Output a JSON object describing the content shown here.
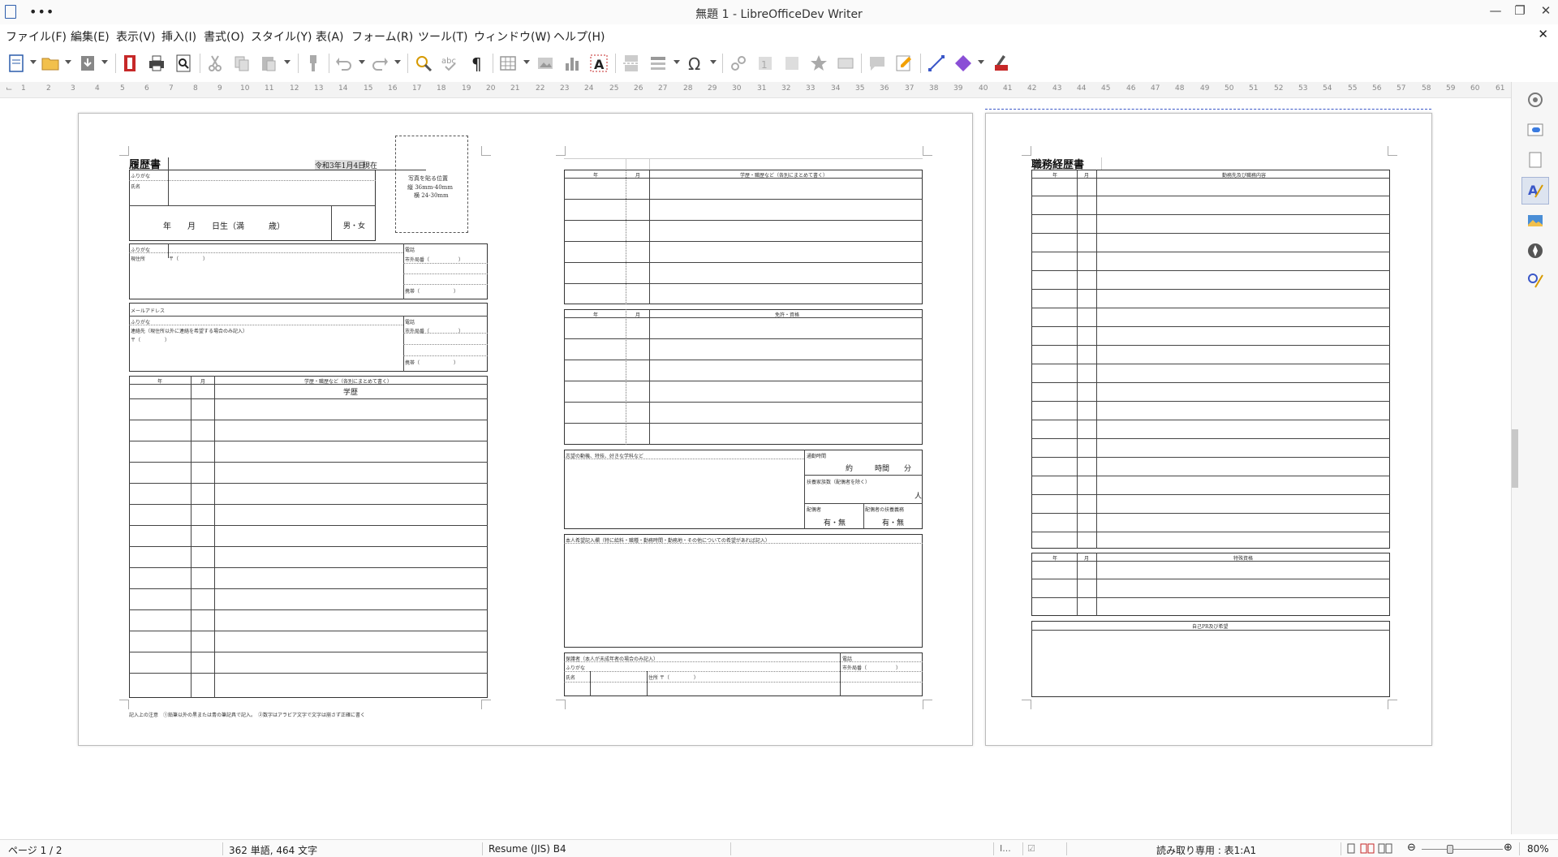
{
  "window": {
    "title": "無題 1 - LibreOfficeDev Writer",
    "more_label": "•••"
  },
  "menu": {
    "items": [
      "ファイル(F)",
      "編集(E)",
      "表示(V)",
      "挿入(I)",
      "書式(O)",
      "スタイル(Y)",
      "表(A)",
      "フォーム(R)",
      "ツール(T)",
      "ウィンドウ(W)",
      "ヘルプ(H)"
    ]
  },
  "ruler": {
    "ticks": [
      "1",
      "2",
      "3",
      "4",
      "5",
      "6",
      "7",
      "8",
      "9",
      "10",
      "11",
      "12",
      "13",
      "14",
      "15",
      "16",
      "17",
      "18",
      "19",
      "20",
      "21",
      "22",
      "23",
      "24",
      "25",
      "26",
      "27",
      "28",
      "29",
      "30",
      "31",
      "32",
      "33",
      "34",
      "35",
      "36",
      "37",
      "38",
      "39",
      "40",
      "41",
      "42",
      "43",
      "44",
      "45",
      "46",
      "47",
      "48",
      "49",
      "50",
      "51",
      "52",
      "53",
      "54",
      "55",
      "56",
      "57",
      "58",
      "59",
      "60",
      "61"
    ]
  },
  "page1": {
    "left": {
      "title": "履歴書",
      "date": "令和3年1月4日",
      "date_suffix": "現在",
      "furigana": "ふりがな",
      "name": "氏名",
      "birth": "年　　月　　日生（満　　　歳）",
      "sex": "男・女",
      "photo_1": "写真を貼る位置",
      "photo_2": "縦 36mm-40mm",
      "photo_3": "横 24-30mm",
      "furigana2": "ふりがな",
      "address": "現住所",
      "postal": "〒（　　　　　）",
      "tel": "電話",
      "ext_1": "市外局番（　　　　　　）",
      "mobile_1": "携帯（　　　　　　　）",
      "email": "メールアドレス",
      "furigana3": "ふりがな",
      "contact": "連絡先（現住所以外に連絡を希望する場合のみ記入）",
      "postal2": "〒（　　　　　）",
      "tel2": "電話",
      "ext_2": "市外局番（　　　　　　）",
      "mobile_2": "携帯（　　　　　　　）",
      "hist_year": "年",
      "hist_month": "月",
      "hist_header": "学歴・職歴など（各別にまとめて書く）",
      "gakureki": "学歴",
      "footnote": "記入上の注意　①鉛筆以外の黒または青の筆記具で記入。　②数字はアラビア文字で文字は崩さず正確に書く"
    },
    "right": {
      "t1_year": "年",
      "t1_month": "月",
      "t1_header": "学歴・職歴など（各別にまとめて書く）",
      "t2_year": "年",
      "t2_month": "月",
      "t2_header": "免許・資格",
      "motive": "志望の動機、特技、好きな学科など",
      "commute": "通勤時間",
      "commute_value": "約　　　時間　　分",
      "dependents": "扶養家族数（配偶者を除く）",
      "dependents_unit": "人",
      "spouse": "配偶者",
      "spouse_duty": "配偶者の扶養義務",
      "spouse_val": "有・無",
      "spouse_duty_val": "有・無",
      "wish": "本人希望記入欄（特に給料・職種・勤務時間・勤務地・その他についての希望があれば記入）",
      "guardian": "保護者（本人が未成年者の場合のみ記入）",
      "g_tel": "電話",
      "g_furigana": "ふりがな",
      "g_ext": "市外局番（　　　　　　）",
      "g_name": "氏名",
      "g_address": "住所 〒（　　　　　）"
    }
  },
  "page2": {
    "title": "職務経歴書",
    "t1_year": "年",
    "t1_month": "月",
    "t1_header": "勤務先及び職務内容",
    "t2_year": "年",
    "t2_month": "月",
    "t2_header": "特殊資格",
    "pr_header": "自己PR及び希望"
  },
  "status": {
    "page": "ページ 1 / 2",
    "words": "362 単語, 464 文字",
    "style": "Resume (JIS) B4",
    "readonly": "読み取り専用 : 表1:A1",
    "zoom": "80%"
  }
}
